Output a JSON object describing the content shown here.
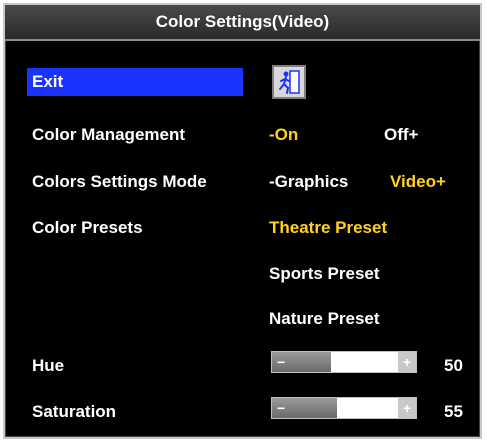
{
  "window": {
    "title": "Color Settings(Video)"
  },
  "menu": {
    "exit_label": "Exit",
    "exit_icon": "exit-door-icon",
    "color_management": {
      "label": "Color Management",
      "options": [
        "-On",
        "Off+"
      ]
    },
    "colors_settings_mode": {
      "label": "Colors Settings Mode",
      "options": [
        "-Graphics",
        "Video+"
      ]
    },
    "color_presets": {
      "label": "Color Presets",
      "options": [
        "Theatre Preset",
        "Sports Preset",
        "Nature Preset"
      ]
    },
    "hue": {
      "label": "Hue",
      "value": "50",
      "fraction": 0.5
    },
    "saturation": {
      "label": "Saturation",
      "value": "55",
      "fraction": 0.55
    }
  },
  "colors": {
    "background": "#000000",
    "highlight": "#1a33ff",
    "selected": "#ffd21f",
    "text": "#ffffff"
  }
}
